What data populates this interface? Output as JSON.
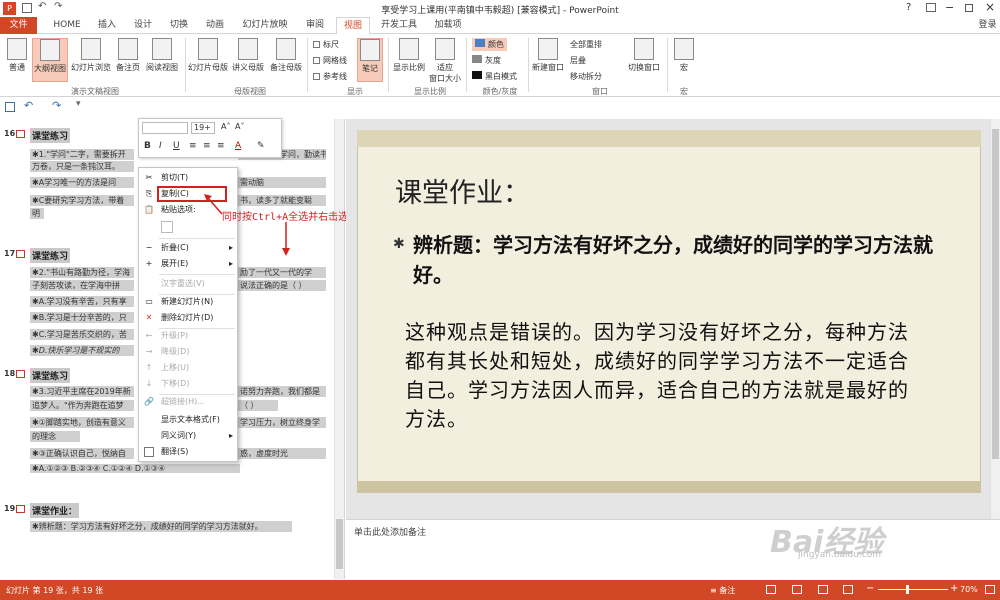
{
  "window": {
    "title": "享受学习上课用(平南镇中韦毅超) [兼容模式] - PowerPoint",
    "help": "?",
    "login": "登录"
  },
  "tabs": [
    "文件",
    "HOME",
    "插入",
    "设计",
    "切换",
    "动画",
    "幻灯片放映",
    "审阅",
    "视图",
    "开发工具",
    "加载项"
  ],
  "ribbon": {
    "views": [
      "普通",
      "大纲视图",
      "幻灯片浏览",
      "备注页",
      "阅读视图"
    ],
    "masters": [
      "幻灯片母版",
      "讲义母版",
      "备注母版"
    ],
    "show": [
      "标尺",
      "网格线",
      "参考线"
    ],
    "notes_btn": "笔记",
    "zoom": [
      "显示比例",
      "适应\n窗口大小"
    ],
    "color": [
      "颜色",
      "灰度",
      "黑白模式"
    ],
    "window": [
      "新建窗口",
      "全部重排",
      "层叠",
      "移动拆分"
    ],
    "switch_window": "切换窗口",
    "macro": "宏",
    "groups": [
      "演示文稿视图",
      "母版视图",
      "显示",
      "显示比例",
      "颜色/灰度",
      "窗口",
      "宏"
    ]
  },
  "outline": [
    {
      "num": "16",
      "head": "课堂练习",
      "lines": [
        "✱1.\"学问\"二字，需要拆开",
        "万卷，只是一条钝汉耳。",
        "✱A学习唯一的方法是问",
        "✱C要研究学习方法，带着",
        "明"
      ]
    },
    {
      "num": "17",
      "head": "课堂练习",
      "lines": [
        "✱2.\"书山有路勤为径，学海",
        "子刻苦攻读，在学海中拼",
        "✱A.学习没有辛苦，只有享",
        "✱B.学习是十分辛苦的，只",
        "✱C.学习是苦乐交织的，苦",
        "✱D.快乐学习是不现实的"
      ]
    },
    {
      "num": "18",
      "head": "课堂练习",
      "lines": [
        "✱3.习近平主席在2019年新",
        "追梦人。\"作为奔跑在追梦",
        "✱①脚踏实地，创造有意义",
        "的理念",
        "✱③正确认识自己，悦纳自",
        "✱A.①②③    B.②③④    C.①②④    D.①③④"
      ]
    },
    {
      "num": "19",
      "head": "课堂作业：",
      "lines": [
        "✱辨析题：学习方法有好坏之分，成绩好的同学的学习方法就好。"
      ]
    }
  ],
  "outline_right": [
    "们学习如何学问，勤读书",
    "需动脑",
    "书，读多了就能变聪",
    "励了一代又一代的学",
    "说法正确的是（    ）",
    "诺努力奔跑，我们都是",
    "（    ）",
    "学习压力，树立终身学",
    "惑，虚度时光"
  ],
  "minitoolbar": {
    "font": "",
    "size": "19+",
    "grow": "A˄",
    "shrink": "A˅"
  },
  "context_menu": [
    {
      "label": "剪切(T)",
      "icon": "✂",
      "enabled": true
    },
    {
      "label": "复制(C)",
      "icon": "⎘",
      "enabled": true
    },
    {
      "label": "粘贴选项:",
      "icon": "📋",
      "enabled": true
    },
    {
      "label": "",
      "icon": "📋",
      "enabled": false
    },
    {
      "label": "折叠(C)",
      "icon": "−",
      "enabled": true,
      "sub": true
    },
    {
      "label": "展开(E)",
      "icon": "+",
      "enabled": true,
      "sub": true
    },
    {
      "label": "汉字重选(V)",
      "icon": "",
      "enabled": false
    },
    {
      "label": "新建幻灯片(N)",
      "icon": "▭",
      "enabled": true
    },
    {
      "label": "删除幻灯片(D)",
      "icon": "✕",
      "enabled": true
    },
    {
      "label": "升级(P)",
      "icon": "←",
      "enabled": false
    },
    {
      "label": "降级(D)",
      "icon": "→",
      "enabled": false
    },
    {
      "label": "上移(U)",
      "icon": "↑",
      "enabled": false
    },
    {
      "label": "下移(D)",
      "icon": "↓",
      "enabled": false
    },
    {
      "label": "超链接(H)...",
      "icon": "🔗",
      "enabled": false
    },
    {
      "label": "显示文本格式(F)",
      "icon": "",
      "enabled": true
    },
    {
      "label": "同义词(Y)",
      "icon": "",
      "enabled": true,
      "sub": true
    },
    {
      "label": "翻译(S)",
      "icon": "",
      "enabled": true
    }
  ],
  "annotation": "同时按Ctrl+A全选并右击选择复制",
  "slide": {
    "title": "课堂作业：",
    "bullet": "辨析题：学习方法有好坏之分，成绩好的同学的学习方法就好。",
    "body": "这种观点是错误的。因为学习没有好坏之分，每种方法都有其长处和短处，成绩好的同学学习方法不一定适合自己。学习方法因人而异，适合自己的方法就是最好的方法。"
  },
  "notes_placeholder": "单击此处添加备注",
  "status": {
    "slide_info": "幻灯片 第 19 张，共 19 张",
    "notes": "备注",
    "zoom": "70%"
  },
  "watermark": {
    "logo": "Bai经验",
    "url": "jingyan.baidu.com"
  },
  "colors": {
    "accent": "#d24726",
    "highlight": "#d32020",
    "slide_bg": "#f3efdf"
  }
}
